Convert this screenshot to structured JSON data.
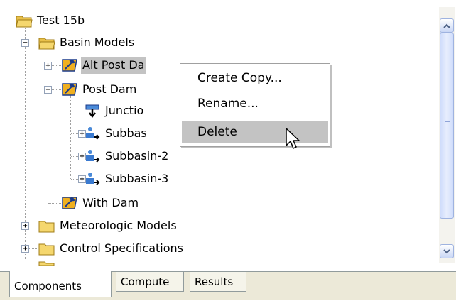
{
  "tree": {
    "nodes": [
      {
        "label": "Test 15b"
      },
      {
        "label": "Basin Models"
      },
      {
        "label": "Alt Post Da"
      },
      {
        "label": "Post Dam"
      },
      {
        "label": "Junctio"
      },
      {
        "label": "Subbas"
      },
      {
        "label": "Subbasin-2"
      },
      {
        "label": "Subbasin-3"
      },
      {
        "label": "With Dam"
      },
      {
        "label": "Meteorologic Models"
      },
      {
        "label": "Control Specifications"
      }
    ]
  },
  "context_menu": {
    "items": [
      {
        "label": "Create Copy..."
      },
      {
        "label": "Rename..."
      },
      {
        "label": "Delete"
      }
    ]
  },
  "tabs": [
    {
      "label": "Components"
    },
    {
      "label": "Compute"
    },
    {
      "label": "Results"
    }
  ],
  "colors": {
    "folder": "#f5d76e",
    "selection": "#c3c3c3",
    "scrollbar_accent": "#c8d6f5"
  }
}
